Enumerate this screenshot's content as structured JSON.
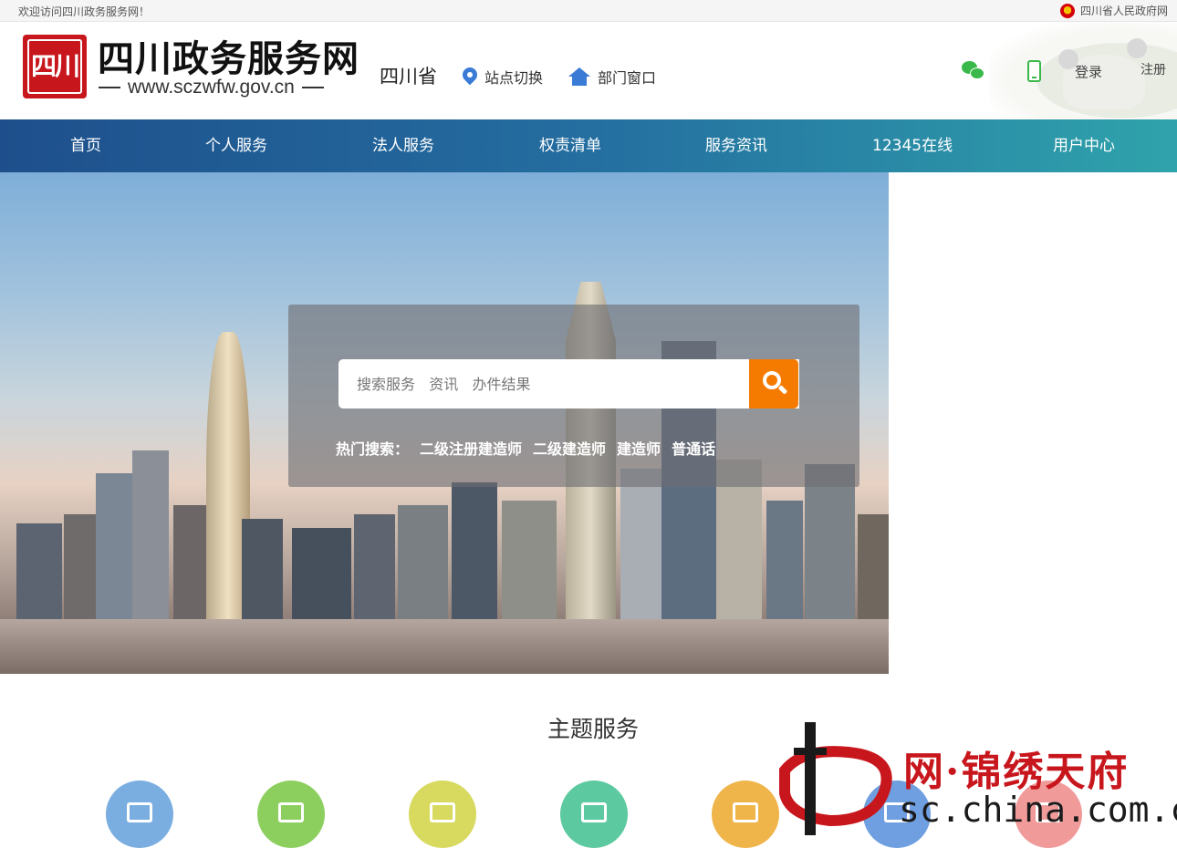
{
  "topbar": {
    "welcome": "欢迎访问四川政务服务网！",
    "gov_link": "四川省人民政府网"
  },
  "header": {
    "logo_glyph": "四川",
    "title": "四川政务服务网",
    "url": "www.sczwfw.gov.cn",
    "province": "四川省",
    "site_switch": "站点切换",
    "dept_window": "部门窗口",
    "login": "登录",
    "register": "注册"
  },
  "nav": {
    "items": [
      "首页",
      "个人服务",
      "法人服务",
      "权责清单",
      "服务资讯",
      "12345在线",
      "用户中心"
    ]
  },
  "search": {
    "placeholder": "搜索服务   资讯   办件结果",
    "hot_label": "热门搜索：",
    "hot_keywords": [
      "二级注册建造师",
      "二级建造师",
      "建造师",
      "普通话"
    ]
  },
  "theme": {
    "title": "主题服务",
    "circle_colors": [
      "#7aaee0",
      "#8dcf5f",
      "#d8d95f",
      "#5cc9a0",
      "#efb54a",
      "#6f9fe0",
      "#f19a9a"
    ]
  },
  "watermark": {
    "line1": "网·锦绣天府",
    "line2": "sc.china.com.cn"
  },
  "colors": {
    "nav_start": "#1e4f8c",
    "nav_end": "#2fa3ab",
    "search_button": "#f57a00",
    "icon_blue": "#3a7bd5",
    "icon_green": "#3ab84a"
  }
}
